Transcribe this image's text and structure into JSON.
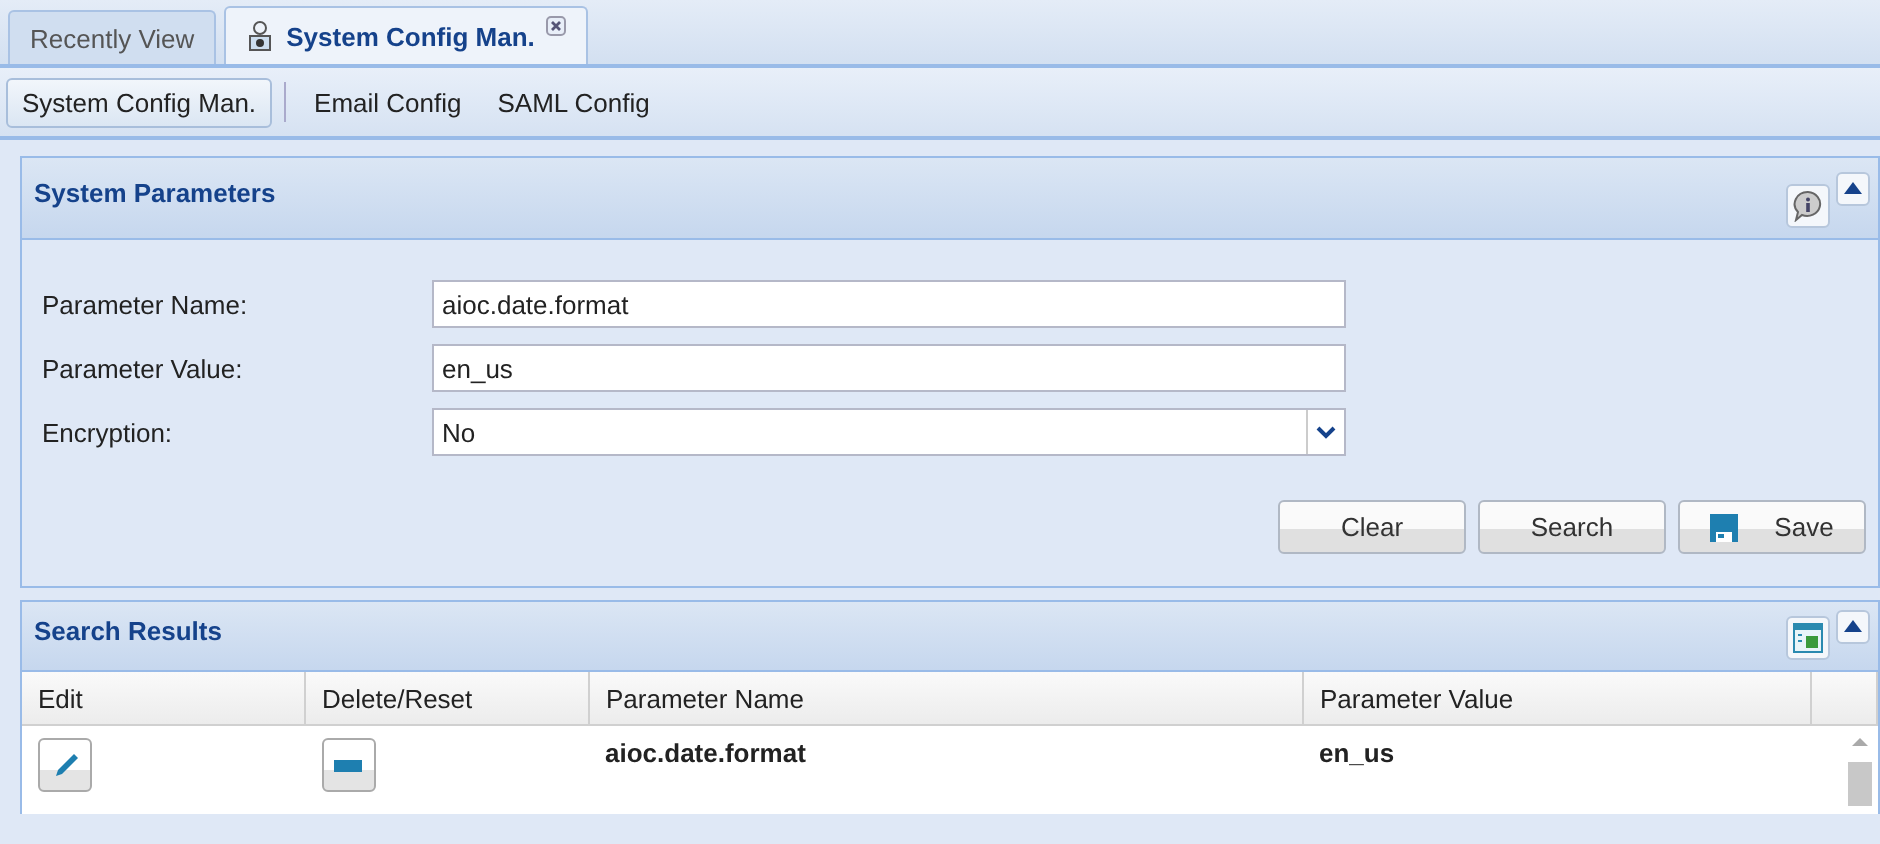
{
  "tabs": [
    {
      "label": "Recently View",
      "selected": false,
      "closable": false
    },
    {
      "label": "System Config Man.",
      "selected": true,
      "closable": true
    }
  ],
  "subnav": [
    {
      "label": "System Config Man.",
      "selected": true
    },
    {
      "label": "Email Config",
      "selected": false
    },
    {
      "label": "SAML Config",
      "selected": false
    }
  ],
  "parameters_panel": {
    "title": "System Parameters",
    "fields": [
      {
        "label": "Parameter Name:",
        "value": "aioc.date.format",
        "kind": "text"
      },
      {
        "label": "Parameter Value:",
        "value": "en_us",
        "kind": "text"
      },
      {
        "label": "Encryption:",
        "value": "No",
        "kind": "select"
      }
    ],
    "buttons": [
      {
        "label": "Clear",
        "kind": "plain"
      },
      {
        "label": "Search",
        "kind": "plain"
      },
      {
        "label": "Save",
        "kind": "save"
      }
    ]
  },
  "results_panel": {
    "title": "Search Results",
    "columns": [
      "Edit",
      "Delete/Reset",
      "Parameter Name",
      "Parameter Value"
    ],
    "rows": [
      {
        "name": "aioc.date.format",
        "value": "en_us"
      }
    ]
  }
}
